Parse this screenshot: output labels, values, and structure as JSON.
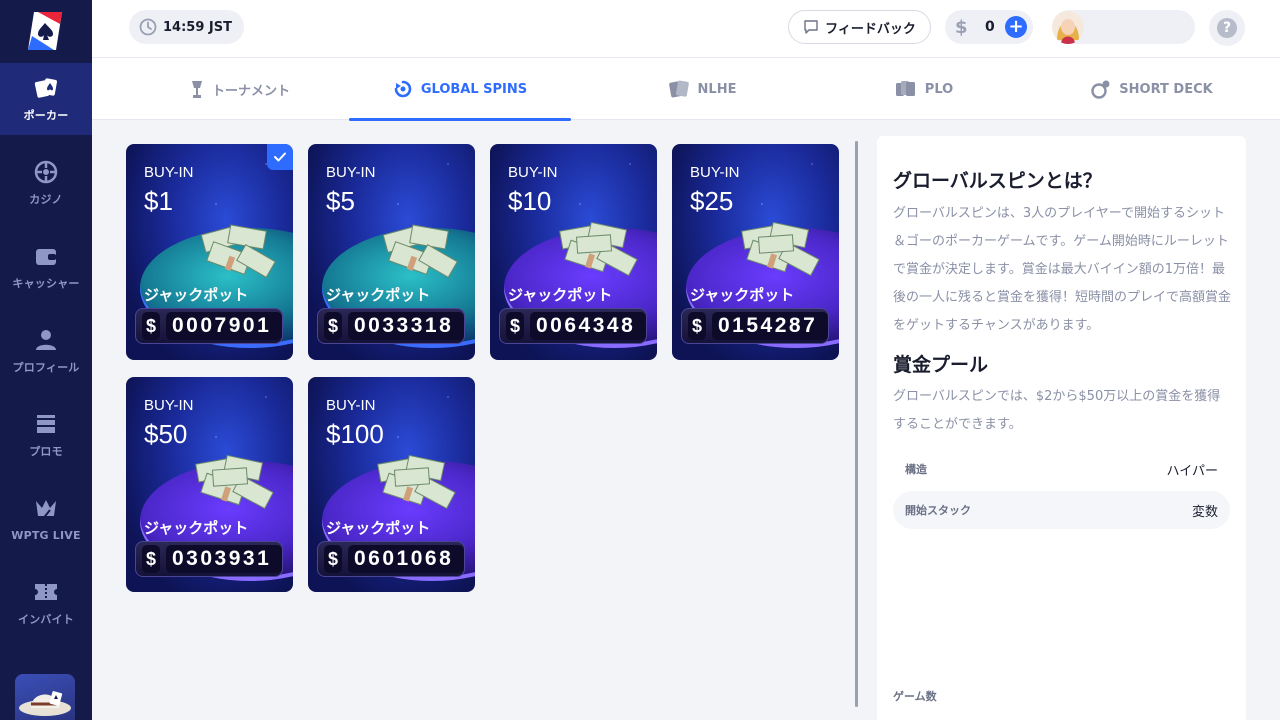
{
  "sidebar": {
    "items": [
      {
        "label": "ポーカー",
        "icon": "poker-cards-icon",
        "active": true
      },
      {
        "label": "カジノ",
        "icon": "roulette-icon",
        "active": false
      },
      {
        "label": "キャッシャー",
        "icon": "wallet-icon",
        "active": false
      },
      {
        "label": "プロフィール",
        "icon": "user-icon",
        "active": false
      },
      {
        "label": "プロモ",
        "icon": "gift-icon",
        "active": false
      },
      {
        "label": "WPTG LIVE",
        "icon": "crown-icon",
        "active": false
      },
      {
        "label": "インバイト",
        "icon": "ticket-icon",
        "active": false
      }
    ]
  },
  "header": {
    "time": "14:59 JST",
    "feedback_label": "フィードバック",
    "balance_symbol": "$",
    "balance": "0",
    "add_funds": "+",
    "help": "?"
  },
  "tabs": [
    {
      "label": "トーナメント",
      "icon": "trophy-icon",
      "active": false
    },
    {
      "label": "GLOBAL SPINS",
      "icon": "spin-icon",
      "active": true
    },
    {
      "label": "NLHE",
      "icon": "cards-icon",
      "active": false
    },
    {
      "label": "PLO",
      "icon": "cards-stack-icon",
      "active": false
    },
    {
      "label": "SHORT DECK",
      "icon": "dice-icon",
      "active": false
    }
  ],
  "cards": [
    {
      "buyin_label": "BUY-IN",
      "buyin": "$1",
      "jackpot_label": "ジャックポット",
      "jackpot_symbol": "$",
      "jackpot": "0007901",
      "theme": "teal",
      "selected": true
    },
    {
      "buyin_label": "BUY-IN",
      "buyin": "$5",
      "jackpot_label": "ジャックポット",
      "jackpot_symbol": "$",
      "jackpot": "0033318",
      "theme": "teal",
      "selected": false
    },
    {
      "buyin_label": "BUY-IN",
      "buyin": "$10",
      "jackpot_label": "ジャックポット",
      "jackpot_symbol": "$",
      "jackpot": "0064348",
      "theme": "purple",
      "selected": false
    },
    {
      "buyin_label": "BUY-IN",
      "buyin": "$25",
      "jackpot_label": "ジャックポット",
      "jackpot_symbol": "$",
      "jackpot": "0154287",
      "theme": "purple",
      "selected": false
    },
    {
      "buyin_label": "BUY-IN",
      "buyin": "$50",
      "jackpot_label": "ジャックポット",
      "jackpot_symbol": "$",
      "jackpot": "0303931",
      "theme": "purple",
      "selected": false
    },
    {
      "buyin_label": "BUY-IN",
      "buyin": "$100",
      "jackpot_label": "ジャックポット",
      "jackpot_symbol": "$",
      "jackpot": "0601068",
      "theme": "purple",
      "selected": false
    }
  ],
  "info": {
    "title": "グローバルスピンとは？",
    "description": "グローバルスピンは、3人のプレイヤーで開始するシット＆ゴーのポーカーゲームです。ゲーム開始時にルーレットで賞金が決定します。賞金は最大バイイン額の1万倍！最後の一人に残ると賞金を獲得！短時間のプレイで高額賞金をゲットするチャンスがあります。",
    "pool_title": "賞金プール",
    "pool_description": "グローバルスピンでは、$2から$50万以上の賞金を獲得することができます。",
    "rows": [
      {
        "key": "構造",
        "value": "ハイパー"
      },
      {
        "key": "開始スタック",
        "value": "変数"
      }
    ],
    "games_label": "ゲーム数"
  },
  "colors": {
    "accent": "#2e6bff",
    "sidebar_bg": "#141a4a",
    "sidebar_active": "#1f2a78",
    "page_bg": "#f2f4f8"
  }
}
